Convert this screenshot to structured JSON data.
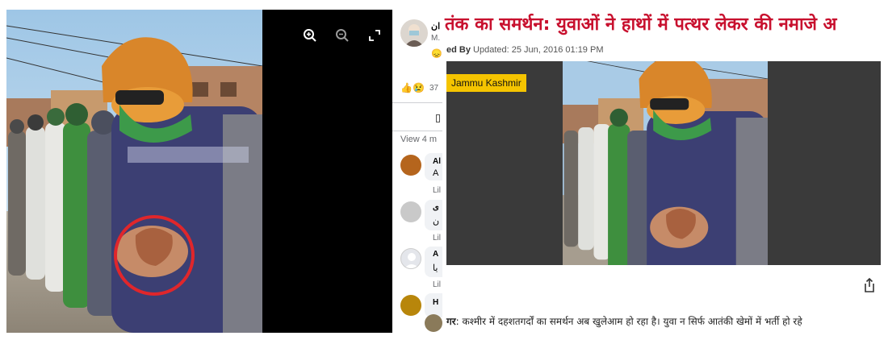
{
  "colors": {
    "headline": "#c8102e",
    "tag_bg": "#f5c400",
    "viewer_bg": "#000000",
    "media_bg": "#3a3a3a",
    "annotation_circle": "#e0262b"
  },
  "viewer": {
    "tools": [
      {
        "name": "zoom-in-icon"
      },
      {
        "name": "zoom-out-icon"
      },
      {
        "name": "fullscreen-icon"
      }
    ]
  },
  "comments": {
    "post_author": "ان",
    "post_author_sub": "M.",
    "reaction_emoji": "😞",
    "reactions_count": "37",
    "reaction_icons": "👍😢",
    "view_more": "View 4 m",
    "items": [
      {
        "name": "Al",
        "text": "A",
        "action": "Lil"
      },
      {
        "name": "ی",
        "text": "ن",
        "action": "Lil"
      },
      {
        "name": "A",
        "text": "یا",
        "action": "Lil"
      },
      {
        "name": "H",
        "text": "",
        "action": ""
      }
    ]
  },
  "article": {
    "headline": "तंक का समर्थन: युवाओं ने हाथों में पत्थर लेकर की नमाजे अ",
    "byline_prefix": "ed By",
    "byline_updated": "Updated: 25 Jun, 2016 01:19 PM",
    "tag": "Jammu Kashmir",
    "body_lead": "गर",
    "body_text": ": कश्मीर में दहशतगर्दों का समर्थन अब खुलेआम हो रहा है। युवा न सिर्फ आतंकी खेमों में भर्ती हो रहे"
  }
}
